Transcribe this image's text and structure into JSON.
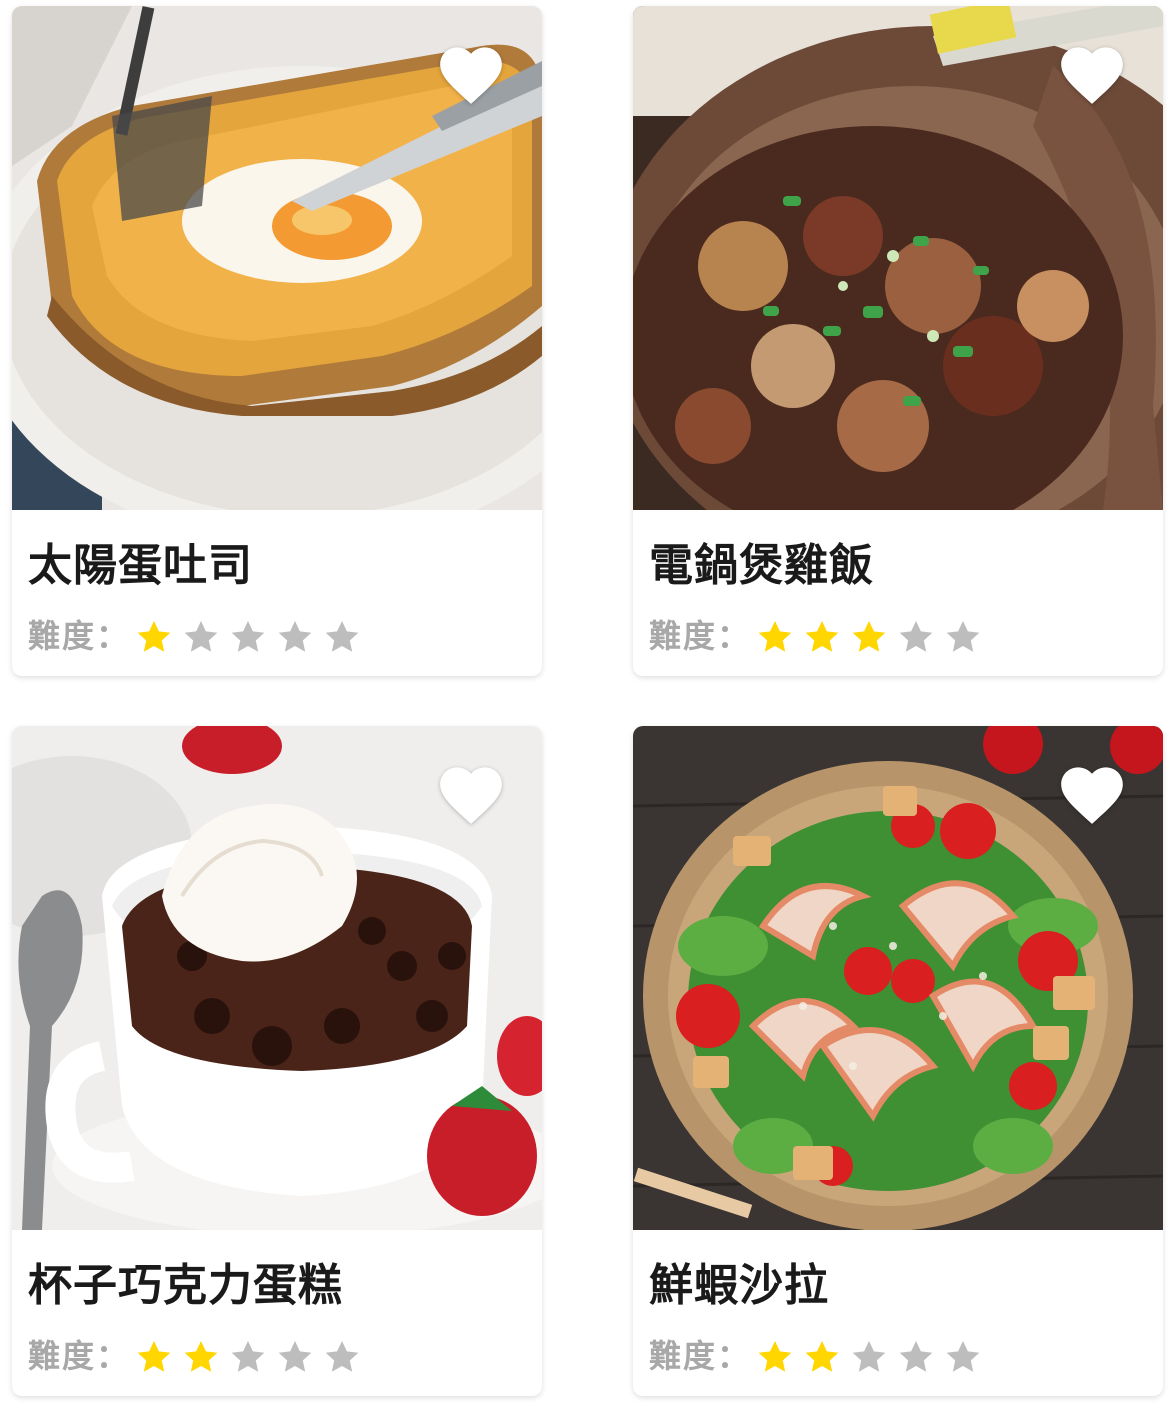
{
  "rating_label": "難度：",
  "colors": {
    "star_filled": "#FFD600",
    "star_empty": "#BDBDBD",
    "heart": "#FFFFFF",
    "title": "#1A1A1A",
    "label": "#A8A8A8"
  },
  "recipes": [
    {
      "title": "太陽蛋吐司",
      "difficulty": 1,
      "max": 5,
      "photo": "egg-toast-photo",
      "favorite_icon": "heart-icon"
    },
    {
      "title": "電鍋煲雞飯",
      "difficulty": 3,
      "max": 5,
      "photo": "claypot-chicken-rice-photo",
      "favorite_icon": "heart-icon"
    },
    {
      "title": "杯子巧克力蛋糕",
      "difficulty": 2,
      "max": 5,
      "photo": "chocolate-mug-cake-photo",
      "favorite_icon": "heart-icon"
    },
    {
      "title": "鮮蝦沙拉",
      "difficulty": 2,
      "max": 5,
      "photo": "shrimp-salad-photo",
      "favorite_icon": "heart-icon"
    }
  ]
}
